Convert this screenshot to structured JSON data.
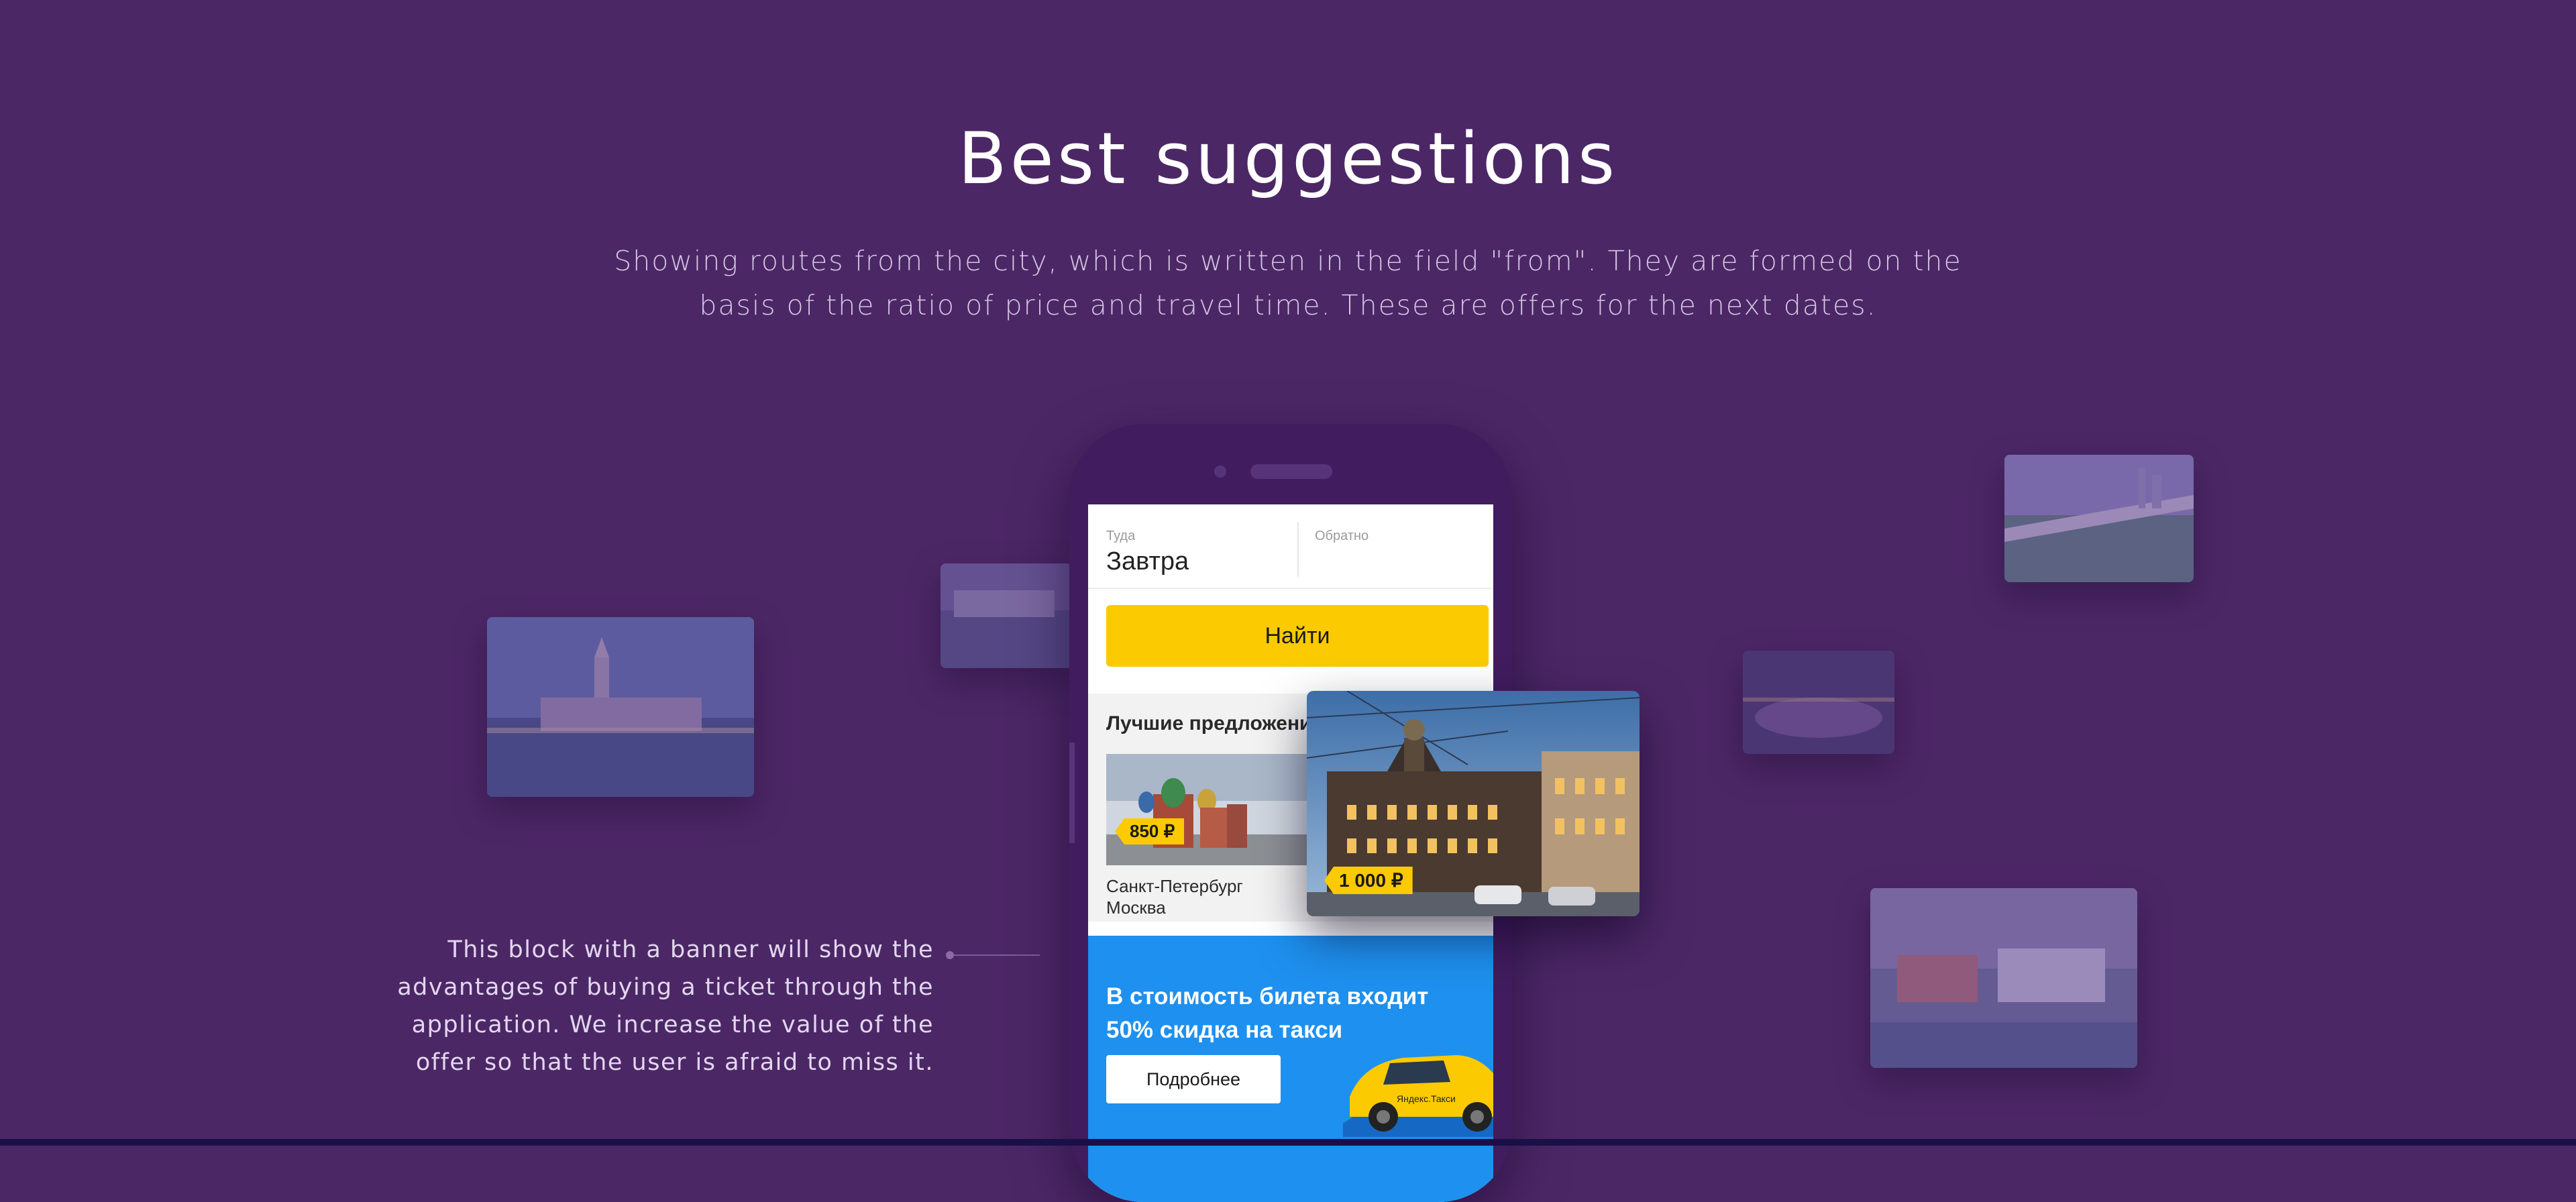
{
  "heading": "Best suggestions",
  "lead_text": "Showing routes from the city, which is written in the field \"from\". They are formed on the basis of the ratio of price and travel time.  These are offers for the next dates.",
  "side_note": "This block with a banner will show the advantages of buying a ticket through the application. We increase the value of the offer so that the user is afraid to miss it.",
  "app": {
    "depart_label": "Туда",
    "depart_value": "Завтра",
    "return_label": "Обратно",
    "return_value": "",
    "search_button": "Найти",
    "best_title": "Лучшие предложения",
    "card": {
      "price": "850 ₽",
      "from_city": "Санкт-Петербург",
      "to_city": "Москва"
    },
    "featured_price": "1 000 ₽",
    "promo_text": "В стоимость билета входит 50% скидка на такси",
    "promo_button": "Подробнее",
    "taxi_brand": "Яндекс.Такси"
  },
  "colors": {
    "background": "#4c2766",
    "accent_yellow": "#fcca00",
    "promo_blue": "#1e90ef"
  }
}
